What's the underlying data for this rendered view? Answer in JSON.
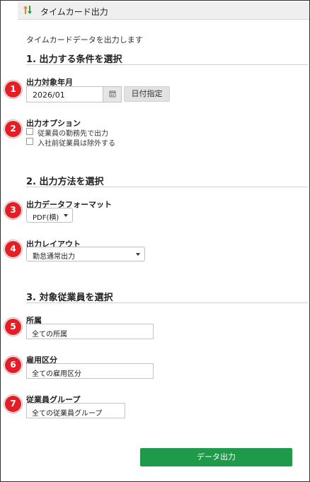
{
  "window": {
    "title": "タイムカード出力",
    "icon": "sort-arrows-icon"
  },
  "intro": "タイムカードデータを出力します",
  "sections": {
    "conditions": "1. 出力する条件を選択",
    "method": "2. 出力方法を選択",
    "employees": "3. 対象従業員を選択"
  },
  "badges": [
    "1",
    "2",
    "3",
    "4",
    "5",
    "6",
    "7"
  ],
  "colors": {
    "badge": "#e31e24",
    "primary_button": "#1f9a4a"
  },
  "year_month": {
    "label": "出力対象年月",
    "value": "2026/01",
    "calendar_icon": "calendar-icon",
    "day_button": "日付指定"
  },
  "options": {
    "label": "出力オプション",
    "items": [
      {
        "label": "従業員の勤務先で出力",
        "checked": false
      },
      {
        "label": "入社前従業員は除外する",
        "checked": false
      }
    ]
  },
  "format": {
    "label": "出力データフォーマット",
    "value": "PDF(横)"
  },
  "layout": {
    "label": "出力レイアウト",
    "value": "勤怠通常出力"
  },
  "department": {
    "label": "所属",
    "value": "全ての所属"
  },
  "employment": {
    "label": "雇用区分",
    "value": "全ての雇用区分"
  },
  "group": {
    "label": "従業員グループ",
    "value": "全ての従業員グループ"
  },
  "submit_label": "データ出力"
}
